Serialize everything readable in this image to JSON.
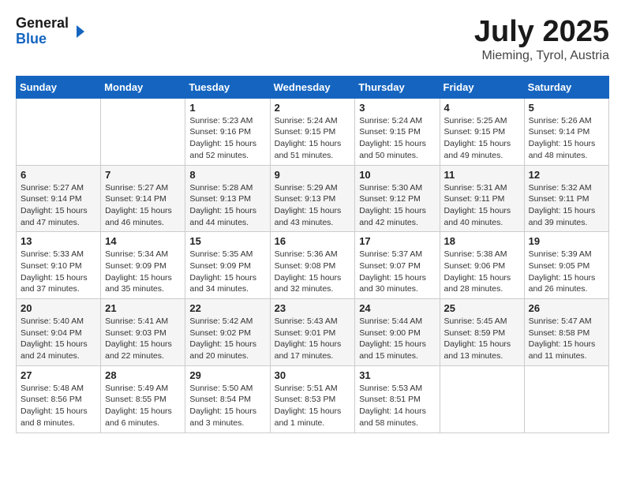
{
  "header": {
    "logo_general": "General",
    "logo_blue": "Blue",
    "month_title": "July 2025",
    "location": "Mieming, Tyrol, Austria"
  },
  "weekdays": [
    "Sunday",
    "Monday",
    "Tuesday",
    "Wednesday",
    "Thursday",
    "Friday",
    "Saturday"
  ],
  "weeks": [
    [
      {
        "day": "",
        "info": ""
      },
      {
        "day": "",
        "info": ""
      },
      {
        "day": "1",
        "info": "Sunrise: 5:23 AM\nSunset: 9:16 PM\nDaylight: 15 hours\nand 52 minutes."
      },
      {
        "day": "2",
        "info": "Sunrise: 5:24 AM\nSunset: 9:15 PM\nDaylight: 15 hours\nand 51 minutes."
      },
      {
        "day": "3",
        "info": "Sunrise: 5:24 AM\nSunset: 9:15 PM\nDaylight: 15 hours\nand 50 minutes."
      },
      {
        "day": "4",
        "info": "Sunrise: 5:25 AM\nSunset: 9:15 PM\nDaylight: 15 hours\nand 49 minutes."
      },
      {
        "day": "5",
        "info": "Sunrise: 5:26 AM\nSunset: 9:14 PM\nDaylight: 15 hours\nand 48 minutes."
      }
    ],
    [
      {
        "day": "6",
        "info": "Sunrise: 5:27 AM\nSunset: 9:14 PM\nDaylight: 15 hours\nand 47 minutes."
      },
      {
        "day": "7",
        "info": "Sunrise: 5:27 AM\nSunset: 9:14 PM\nDaylight: 15 hours\nand 46 minutes."
      },
      {
        "day": "8",
        "info": "Sunrise: 5:28 AM\nSunset: 9:13 PM\nDaylight: 15 hours\nand 44 minutes."
      },
      {
        "day": "9",
        "info": "Sunrise: 5:29 AM\nSunset: 9:13 PM\nDaylight: 15 hours\nand 43 minutes."
      },
      {
        "day": "10",
        "info": "Sunrise: 5:30 AM\nSunset: 9:12 PM\nDaylight: 15 hours\nand 42 minutes."
      },
      {
        "day": "11",
        "info": "Sunrise: 5:31 AM\nSunset: 9:11 PM\nDaylight: 15 hours\nand 40 minutes."
      },
      {
        "day": "12",
        "info": "Sunrise: 5:32 AM\nSunset: 9:11 PM\nDaylight: 15 hours\nand 39 minutes."
      }
    ],
    [
      {
        "day": "13",
        "info": "Sunrise: 5:33 AM\nSunset: 9:10 PM\nDaylight: 15 hours\nand 37 minutes."
      },
      {
        "day": "14",
        "info": "Sunrise: 5:34 AM\nSunset: 9:09 PM\nDaylight: 15 hours\nand 35 minutes."
      },
      {
        "day": "15",
        "info": "Sunrise: 5:35 AM\nSunset: 9:09 PM\nDaylight: 15 hours\nand 34 minutes."
      },
      {
        "day": "16",
        "info": "Sunrise: 5:36 AM\nSunset: 9:08 PM\nDaylight: 15 hours\nand 32 minutes."
      },
      {
        "day": "17",
        "info": "Sunrise: 5:37 AM\nSunset: 9:07 PM\nDaylight: 15 hours\nand 30 minutes."
      },
      {
        "day": "18",
        "info": "Sunrise: 5:38 AM\nSunset: 9:06 PM\nDaylight: 15 hours\nand 28 minutes."
      },
      {
        "day": "19",
        "info": "Sunrise: 5:39 AM\nSunset: 9:05 PM\nDaylight: 15 hours\nand 26 minutes."
      }
    ],
    [
      {
        "day": "20",
        "info": "Sunrise: 5:40 AM\nSunset: 9:04 PM\nDaylight: 15 hours\nand 24 minutes."
      },
      {
        "day": "21",
        "info": "Sunrise: 5:41 AM\nSunset: 9:03 PM\nDaylight: 15 hours\nand 22 minutes."
      },
      {
        "day": "22",
        "info": "Sunrise: 5:42 AM\nSunset: 9:02 PM\nDaylight: 15 hours\nand 20 minutes."
      },
      {
        "day": "23",
        "info": "Sunrise: 5:43 AM\nSunset: 9:01 PM\nDaylight: 15 hours\nand 17 minutes."
      },
      {
        "day": "24",
        "info": "Sunrise: 5:44 AM\nSunset: 9:00 PM\nDaylight: 15 hours\nand 15 minutes."
      },
      {
        "day": "25",
        "info": "Sunrise: 5:45 AM\nSunset: 8:59 PM\nDaylight: 15 hours\nand 13 minutes."
      },
      {
        "day": "26",
        "info": "Sunrise: 5:47 AM\nSunset: 8:58 PM\nDaylight: 15 hours\nand 11 minutes."
      }
    ],
    [
      {
        "day": "27",
        "info": "Sunrise: 5:48 AM\nSunset: 8:56 PM\nDaylight: 15 hours\nand 8 minutes."
      },
      {
        "day": "28",
        "info": "Sunrise: 5:49 AM\nSunset: 8:55 PM\nDaylight: 15 hours\nand 6 minutes."
      },
      {
        "day": "29",
        "info": "Sunrise: 5:50 AM\nSunset: 8:54 PM\nDaylight: 15 hours\nand 3 minutes."
      },
      {
        "day": "30",
        "info": "Sunrise: 5:51 AM\nSunset: 8:53 PM\nDaylight: 15 hours\nand 1 minute."
      },
      {
        "day": "31",
        "info": "Sunrise: 5:53 AM\nSunset: 8:51 PM\nDaylight: 14 hours\nand 58 minutes."
      },
      {
        "day": "",
        "info": ""
      },
      {
        "day": "",
        "info": ""
      }
    ]
  ]
}
